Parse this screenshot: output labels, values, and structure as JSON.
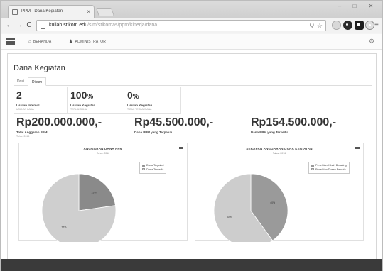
{
  "browser": {
    "tab_title": "PPM - Dana Kegiatan",
    "tab_close": "×",
    "url_host": "kuliah.stikom.edu",
    "url_path": "/sim/stikomas/ppm/kinerja/dana",
    "window_min": "–",
    "window_max": "□",
    "window_close": "✕",
    "back": "←",
    "forward": "→",
    "reload": "C",
    "zoom": "Q",
    "star": "☆",
    "menu": "≡"
  },
  "app": {
    "nav": [
      {
        "icon": "home-icon",
        "glyph": "⌂",
        "label": "BERANDA"
      },
      {
        "icon": "user-icon",
        "glyph": "♟",
        "label": "ADMINISTRATOR"
      }
    ],
    "settings_glyph": "⚙"
  },
  "page": {
    "title": "Dana Kegiatan",
    "tabs": [
      {
        "label": "Dosi",
        "active": false
      },
      {
        "label": "Dikum",
        "active": true
      }
    ]
  },
  "stats": [
    {
      "value": "2",
      "unit": "",
      "label": "Usulan Internal",
      "sub": "USULAN LAMA"
    },
    {
      "value": "100",
      "unit": "%",
      "label": "Usulan Kegiatan",
      "sub": "TERLAKSANA"
    },
    {
      "value": "0",
      "unit": "%",
      "label": "Usulan Kegiatan",
      "sub": "TIDAK TERLAKSANA"
    }
  ],
  "money": [
    {
      "value": "Rp200.000.000,-",
      "label": "Total Anggaran PPM",
      "sub": "Tahun 2016"
    },
    {
      "value": "Rp45.500.000,-",
      "label": "Dana PPM yang Terpakai",
      "sub": ""
    },
    {
      "value": "Rp154.500.000,-",
      "label": "Dana PPM yang Tersedia",
      "sub": ""
    }
  ],
  "chart_data": [
    {
      "type": "pie",
      "title": "ANGGARAN DANA PPM",
      "subtitle": "Tahun 2016",
      "categories": [
        "Dana Terpakai",
        "Dana Tersedia"
      ],
      "values": [
        22.75,
        77.25
      ],
      "data_labels": [
        "23%",
        "77%"
      ],
      "colors": [
        "#8a8a8a",
        "#cfcfcf"
      ],
      "legend": "top-right"
    },
    {
      "type": "pie",
      "title": "SERAPAN ANGGARAN DANA KEGIATAN",
      "subtitle": "Tahun 2016",
      "categories": [
        "Penelitian Hibah Bersaing",
        "Penelitian Dosen Pemula"
      ],
      "values": [
        40,
        60
      ],
      "data_labels": [
        "40%",
        "60%"
      ],
      "colors": [
        "#9a9a9a",
        "#cdcdcd"
      ],
      "legend": "top-right"
    }
  ]
}
